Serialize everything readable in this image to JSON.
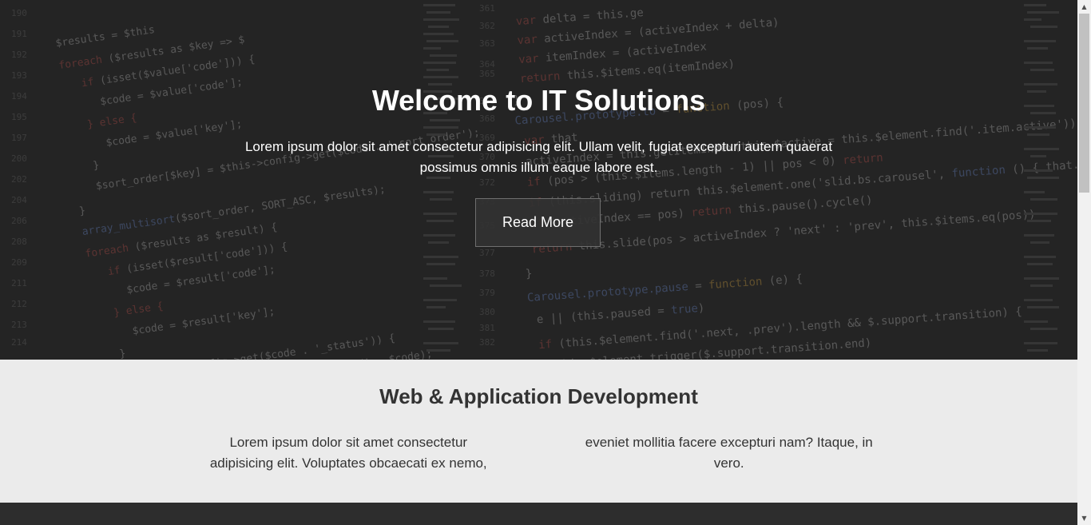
{
  "hero": {
    "title": "Welcome to IT Solutions",
    "text": "Lorem ipsum dolor sit amet consectetur adipisicing elit. Ullam velit, fugiat excepturi autem quaerat possimus omnis illum eaque labore est.",
    "button_label": "Read More"
  },
  "section": {
    "title": "Web & Application Development",
    "text": "Lorem ipsum dolor sit amet consectetur adipisicing elit. Voluptates obcaecati ex nemo, eveniet mollitia facere excepturi nam? Itaque, in vero."
  },
  "colors": {
    "hero_bg": "#2b2b2b",
    "section_bg": "#ebebeb",
    "footer_bg": "#2d2d2d",
    "text_dark": "#333333"
  }
}
